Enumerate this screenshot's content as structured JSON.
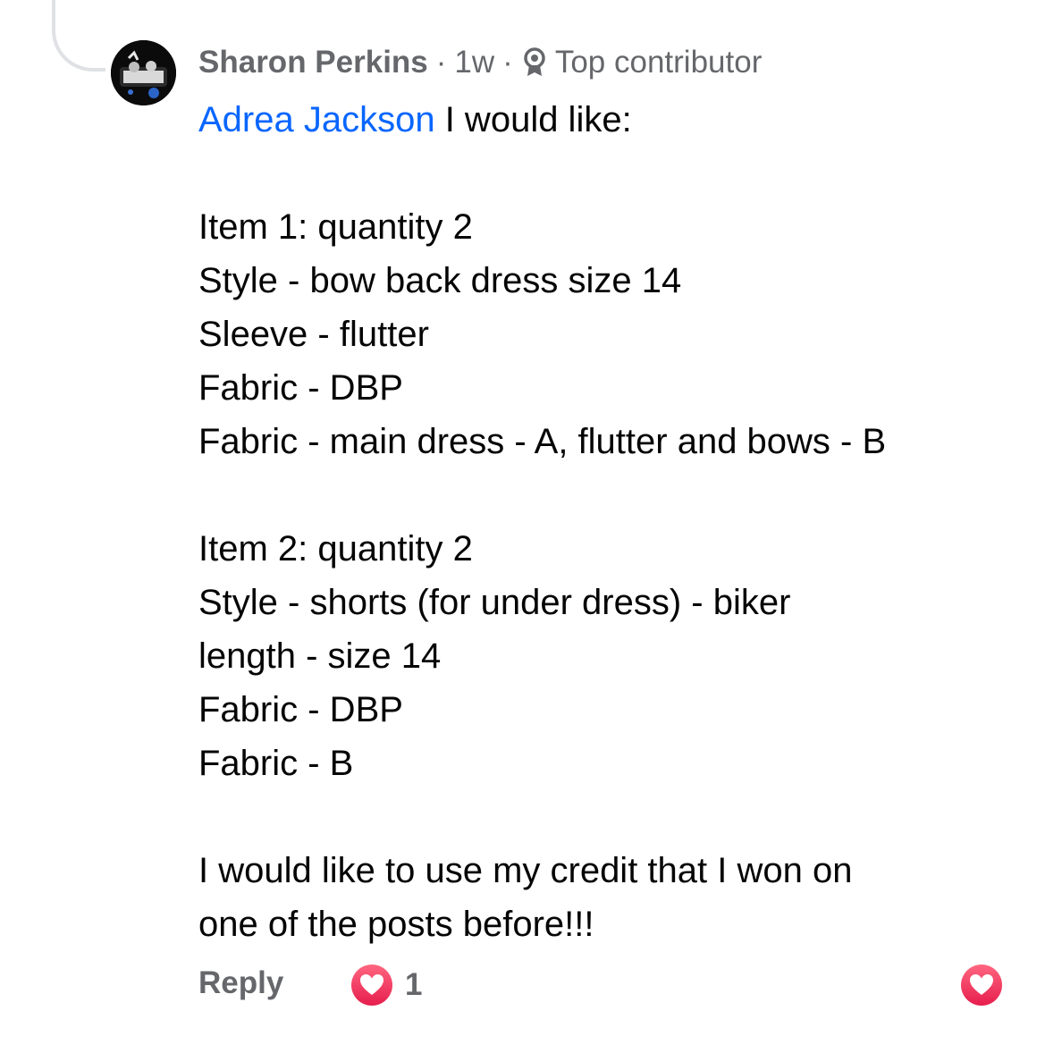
{
  "comment": {
    "author": "Sharon Perkins",
    "separator": "·",
    "time": "1w",
    "badge": {
      "label": "Top contributor",
      "icon": "top-contributor-badge-icon"
    },
    "mention": "Adrea Jackson",
    "lines": [
      " I would like:",
      "",
      "Item 1:  quantity 2",
      "Style - bow back dress size 14",
      "Sleeve - flutter",
      "Fabric - DBP",
      "Fabric - main dress - A, flutter and bows - B",
      "",
      "Item 2: quantity 2",
      "Style - shorts (for under dress) - biker",
      "length - size 14",
      "Fabric - DBP",
      "Fabric - B",
      "",
      "I would like to use my credit that I won on",
      "one of the posts before!!!"
    ]
  },
  "actions": {
    "reply_label": "Reply",
    "reaction": {
      "icon": "heart-reaction-icon",
      "count": "1"
    },
    "like_icon": "heart-icon"
  },
  "colors": {
    "mention": "#0866ff",
    "meta": "#65676b",
    "text": "#050505",
    "heart": "#f0284a"
  }
}
